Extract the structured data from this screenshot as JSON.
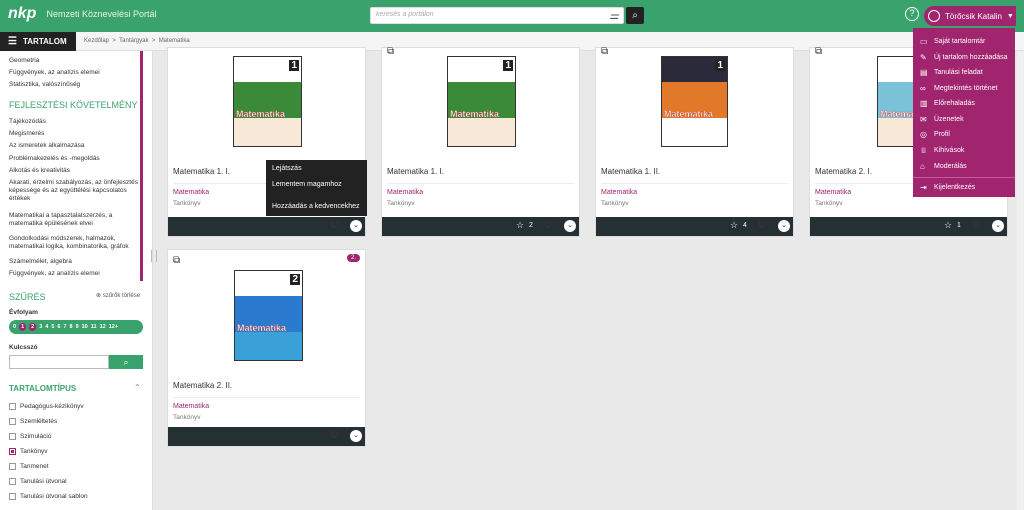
{
  "app": {
    "logo": "nkp",
    "title": "Nemzeti Köznevelési Portál"
  },
  "search": {
    "placeholder": "keresés a portálon",
    "filter_icon": "sliders-icon",
    "button_icon": "search-icon"
  },
  "header": {
    "help": "?",
    "user": "Törőcsik Katalin"
  },
  "nav": {
    "tartalom": "TARTALOM",
    "breadcrumb": [
      "Kezdőlap",
      ">",
      "Tantárgyak",
      ">",
      "Matematika"
    ]
  },
  "sidebar": {
    "topics": [
      "Geometria",
      "Függvények, az analízis elemei",
      "Statisztika, valószínűség"
    ],
    "dev_head": "FEJLESZTÉSI KÖVETELMÉNY",
    "dev": [
      "Tájékozódás",
      "Megismerés",
      "Az ismeretek alkalmazása",
      "Problémakezelés és -megoldás",
      "Alkotás és kreativitás",
      "Akarati, érzelmi szabályozás, az önfejlesztés képessége és az együttélési kapcsolatos értékek",
      "Matematikai a tapasztalatszerzés, a matematika épülésének elvei",
      "Gondolkodási módszerek, halmazok, matematikai logika, kombinatorika, gráfok",
      "Számelmélet, algebra",
      "Függvények, az analízis elemei"
    ],
    "filter_head": "SZŰRÉS",
    "clear": "szűrők törlése",
    "grade_label": "Évfolyam",
    "grades": [
      "0",
      "1",
      "2",
      "3",
      "4",
      "5",
      "6",
      "7",
      "8",
      "9",
      "10",
      "11",
      "12",
      "12+"
    ],
    "kw_label": "Kulcsszó",
    "type_head": "TARTALOMTÍPUS",
    "types": [
      {
        "label": "Pedagógus-kézikönyv",
        "checked": false
      },
      {
        "label": "Szemléltetés",
        "checked": false
      },
      {
        "label": "Szimuláció",
        "checked": false
      },
      {
        "label": "Tankönyv",
        "checked": true
      },
      {
        "label": "Tanmenet",
        "checked": false
      },
      {
        "label": "Tanulási útvonal",
        "checked": false
      },
      {
        "label": "Tanulási útvonal sablon",
        "checked": false
      }
    ]
  },
  "cards": [
    {
      "title": "Matematika 1. I.",
      "subject": "Matematika",
      "type": "Tankönyv",
      "grade": "1",
      "cover_title": "Matematika",
      "stars": "",
      "color": "#3a8a3a"
    },
    {
      "title": "Matematika 1. I.",
      "subject": "Matematika",
      "type": "Tankönyv",
      "grade": "1",
      "cover_title": "Matematika",
      "stars": "2",
      "color": "#3a8a3a"
    },
    {
      "title": "Matematika 1. II.",
      "subject": "Matematika",
      "type": "Tankönyv",
      "grade": "1",
      "cover_title": "Matematika",
      "stars": "4",
      "color": "#e07a2a"
    },
    {
      "title": "Matematika 2. I.",
      "subject": "Matematika",
      "type": "Tankönyv",
      "grade": "2",
      "cover_title": "Matematika",
      "stars": "1",
      "color": "#7bc1d8"
    },
    {
      "title": "Matematika 2. II.",
      "subject": "Matematika",
      "type": "Tankönyv",
      "grade": "2",
      "cover_title": "Matematika",
      "stars": "",
      "badge": "2.",
      "color": "#2a7bd0"
    }
  ],
  "context_menu": [
    "Lejátszás",
    "Lementem magamhoz",
    "Hozzáadás a kedvencekhez"
  ],
  "user_menu": [
    "Saját tartalomtár",
    "Új tartalom hozzáadása",
    "Tanulási feladat",
    "Megtekintés történet",
    "Előrehaladás",
    "Üzenetek",
    "Profil",
    "Kihívások",
    "Moderálás",
    "Kijelentkezés"
  ]
}
